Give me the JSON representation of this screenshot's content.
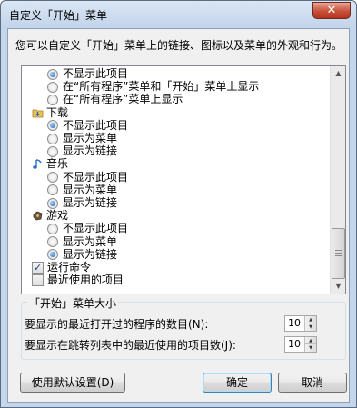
{
  "window": {
    "title": "自定义「开始」菜单",
    "close_glyph": "✕",
    "description": "您可以自定义「开始」菜单上的链接、图标以及菜单的外观和行为。"
  },
  "list": {
    "rows": [
      {
        "kind": "radio",
        "label": "不显示此项目",
        "checked": true
      },
      {
        "kind": "radio",
        "label": "在“所有程序”菜单和「开始」菜单上显示",
        "checked": false
      },
      {
        "kind": "radio",
        "label": "在“所有程序”菜单上显示",
        "checked": false
      },
      {
        "kind": "category",
        "label": "下载",
        "icon": "folder-download-icon"
      },
      {
        "kind": "radio",
        "label": "不显示此项目",
        "checked": true
      },
      {
        "kind": "radio",
        "label": "显示为菜单",
        "checked": false
      },
      {
        "kind": "radio",
        "label": "显示为链接",
        "checked": false
      },
      {
        "kind": "category",
        "label": "音乐",
        "icon": "music-note-icon"
      },
      {
        "kind": "radio",
        "label": "不显示此项目",
        "checked": false
      },
      {
        "kind": "radio",
        "label": "显示为菜单",
        "checked": false
      },
      {
        "kind": "radio",
        "label": "显示为链接",
        "checked": true
      },
      {
        "kind": "category",
        "label": "游戏",
        "icon": "games-icon"
      },
      {
        "kind": "radio",
        "label": "不显示此项目",
        "checked": false
      },
      {
        "kind": "radio",
        "label": "显示为菜单",
        "checked": false
      },
      {
        "kind": "radio",
        "label": "显示为链接",
        "checked": true
      },
      {
        "kind": "checkbox",
        "label": "运行命令",
        "checked": true
      },
      {
        "kind": "checkbox",
        "label": "最近使用的项目",
        "checked": false
      }
    ]
  },
  "size_group": {
    "title": "「开始」菜单大小",
    "recent_programs_label": "要显示的最近打开过的程序的数目(N):",
    "recent_programs_value": "10",
    "jump_list_label": "要显示在跳转列表中的最近使用的项目数(J):",
    "jump_list_value": "10"
  },
  "buttons": {
    "defaults": "使用默认设置(D)",
    "ok": "确定",
    "cancel": "取消"
  },
  "colors": {
    "accent": "#1d5fb8",
    "frame": "#c4d6ec",
    "close": "#c7503a"
  }
}
